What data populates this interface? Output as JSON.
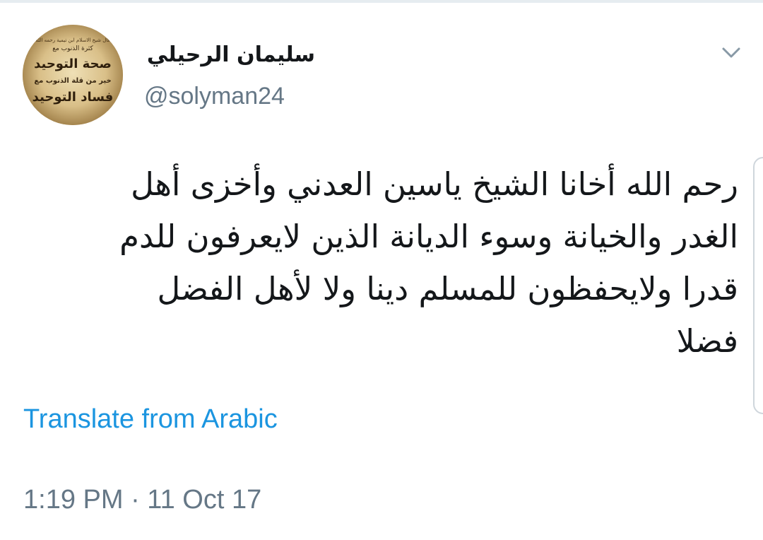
{
  "tweet": {
    "author": {
      "display_name": "سليمان الرحيلي",
      "handle": "@solyman24",
      "avatar": {
        "lines": [
          "قال شيخ الاسلام ابن تيمية رحمه الله",
          "كثرة الذنوب مع",
          "صحة التوحيد",
          "خير من قلة الذنوب مع",
          "فساد التوحيد"
        ]
      }
    },
    "menu_icon": "chevron-down-icon",
    "text_lines": [
      "رحم الله أخانا الشيخ ياسين العدني وأخزى أهل",
      "الغدر والخيانة وسوء الديانة الذين لايعرفون للدم",
      "قدرا ولايحفظون للمسلم دينا ولا لأهل الفضل",
      "فضلا"
    ],
    "translate_label": "Translate from Arabic",
    "timestamp": "1:19 PM · 11 Oct 17"
  },
  "colors": {
    "text_primary": "#14171a",
    "text_secondary": "#657786",
    "link": "#1b95e0",
    "divider": "#e6ecf0"
  }
}
